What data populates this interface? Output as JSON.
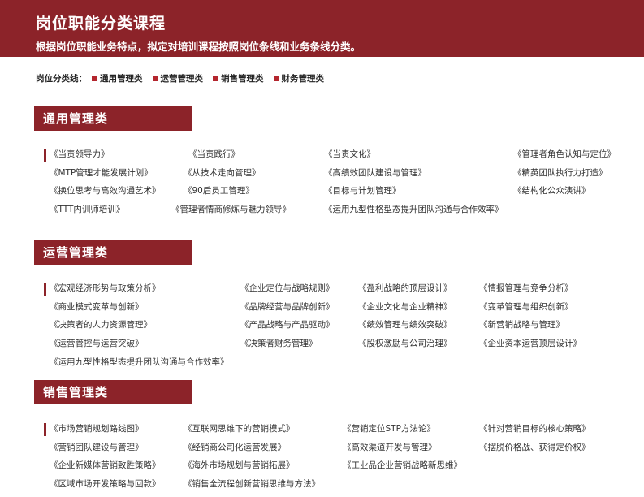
{
  "header": {
    "title": "岗位职能分类课程",
    "subtitle": "根据岗位职能业务特点，拟定对培训课程按照岗位条线和业务条线分类。"
  },
  "legend": {
    "label": "岗位分类线：",
    "items": [
      "通用管理类",
      "运营管理类",
      "销售管理类",
      "财务管理类"
    ],
    "color": "#b4262e"
  },
  "colors": {
    "banner": "#8c2329",
    "accent": "#b4262e"
  },
  "sections": [
    {
      "title": "通用管理类",
      "rows": [
        [
          "《当责领导力》",
          "《当责践行》",
          "《当责文化》",
          "《管理者角色认知与定位》"
        ],
        [
          "《MTP管理才能发展计划》",
          "《从技术走向管理》",
          "《高绩效团队建设与管理》",
          "《精英团队执行力打造》"
        ],
        [
          "《换位思考与高效沟通艺术》",
          "《90后员工管理》",
          "《目标与计划管理》",
          "《结构化公众演讲》"
        ],
        [
          "《TTT内训师培训》",
          "《管理者情商修炼与魅力领导》",
          "《运用九型性格型态提升团队沟通与合作效率》",
          ""
        ]
      ]
    },
    {
      "title": "运营管理类",
      "rows": [
        [
          "《宏观经济形势与政策分析》",
          "《企业定位与战略规则》",
          "《盈利战略的顶层设计》",
          "《情报管理与竞争分析》"
        ],
        [
          "《商业模式变革与创新》",
          "《品牌经营与品牌创新》",
          "《企业文化与企业精神》",
          "《变革管理与组织创新》"
        ],
        [
          "《决策者的人力资源管理》",
          "《产品战略与产品驱动》",
          "《绩效管理与绩效突破》",
          "《新营销战略与管理》"
        ],
        [
          "《运营管控与运营突破》",
          "《决策者财务管理》",
          "《股权激励与公司治理》",
          "《企业资本运营顶层设计》"
        ],
        [
          "《运用九型性格型态提升团队沟通与合作效率》",
          "",
          "",
          ""
        ]
      ]
    },
    {
      "title": "销售管理类",
      "rows": [
        [
          "《市场营销规划路线图》",
          "《互联网思维下的营销模式》",
          "《营销定位STP方法论》",
          "《针对营销目标的核心策略》"
        ],
        [
          "《营销团队建设与管理》",
          "《经销商公司化运营发展》",
          "《高效渠道开发与管理》",
          "《摆脱价格战、获得定价权》"
        ],
        [
          "《企业新媒体营销致胜策略》",
          "《海外市场规划与营销拓展》",
          "《工业品企业营销战略新思维》",
          ""
        ],
        [
          "《区域市场开发策略与回款》",
          "《销售全流程创新营销思维与方法》",
          "",
          ""
        ]
      ]
    }
  ]
}
